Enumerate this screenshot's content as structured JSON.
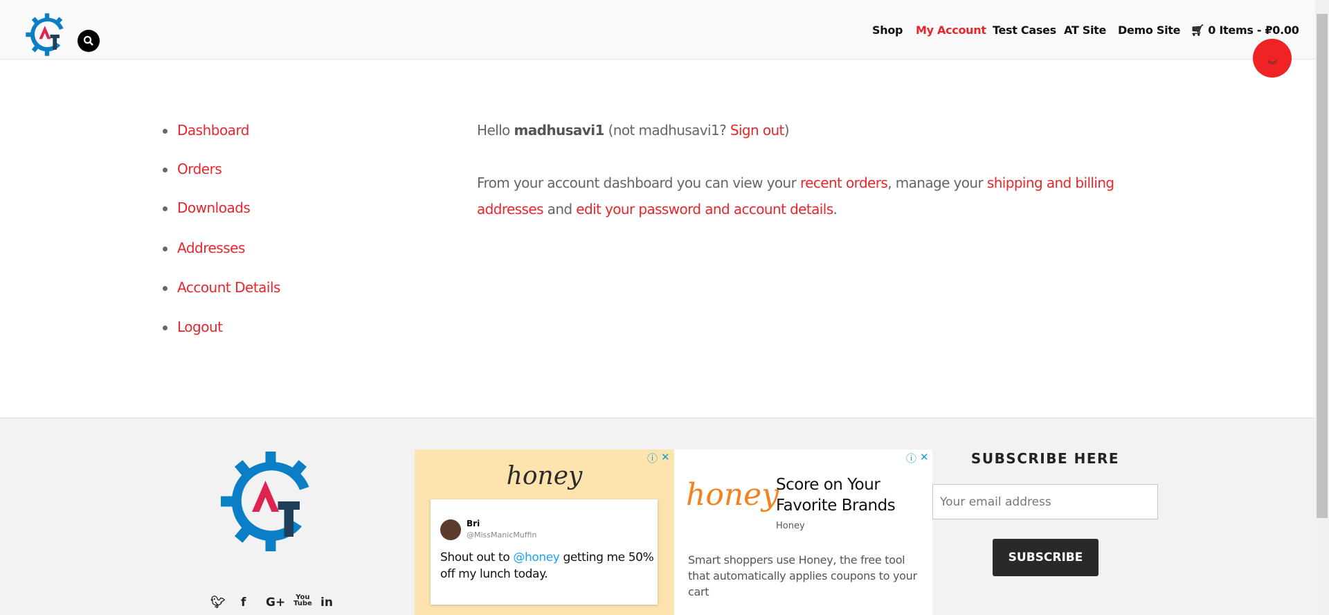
{
  "header": {
    "nav": [
      "Shop",
      "My Account",
      "Test Cases",
      "AT Site",
      "Demo Site"
    ],
    "active_nav": "My Account",
    "cart_label": "0 Items - ₽0.00",
    "logo_text": "AT"
  },
  "sidebar": {
    "items": [
      {
        "label": "Dashboard"
      },
      {
        "label": "Orders"
      },
      {
        "label": "Downloads"
      },
      {
        "label": "Addresses"
      },
      {
        "label": "Account Details"
      },
      {
        "label": "Logout"
      }
    ]
  },
  "main": {
    "hello": "Hello",
    "username": "madhusavi1",
    "not_prefix": "(not madhusavi1?",
    "sign_out": "Sign out",
    "not_suffix": ")",
    "p1": "From your account dashboard you can view your",
    "recent_orders": "recent orders",
    "p2": ", manage your",
    "shipping": "shipping and billing",
    "addresses": "addresses",
    "p3": "and",
    "edit": "edit your password and account details",
    "p4": "."
  },
  "footer": {
    "social": [
      "twitter-icon",
      "facebook-icon",
      "google-plus-icon",
      "youtube-icon",
      "linkedin-icon"
    ],
    "ad_left": {
      "brand": "honey",
      "tweet_name": "Bri",
      "tweet_handle": "@MissManicMuffin",
      "tweet_pre": "Shout out to",
      "tweet_mention": "@honey",
      "tweet_post": "getting me 50% off my lunch today."
    },
    "ad_right": {
      "brand": "honey",
      "headline": "Score on Your Favorite Brands",
      "advertiser": "Honey",
      "body": "Smart shoppers use Honey, the free tool that automatically applies coupons to your cart"
    },
    "subscribe": {
      "heading": "SUBSCRIBE HERE",
      "placeholder": "Your email address",
      "button": "SUBSCRIBE"
    }
  },
  "colors": {
    "accent": "#e8262b",
    "logo_blue": "#0a7fc6",
    "logo_navy": "#1f3e57"
  }
}
